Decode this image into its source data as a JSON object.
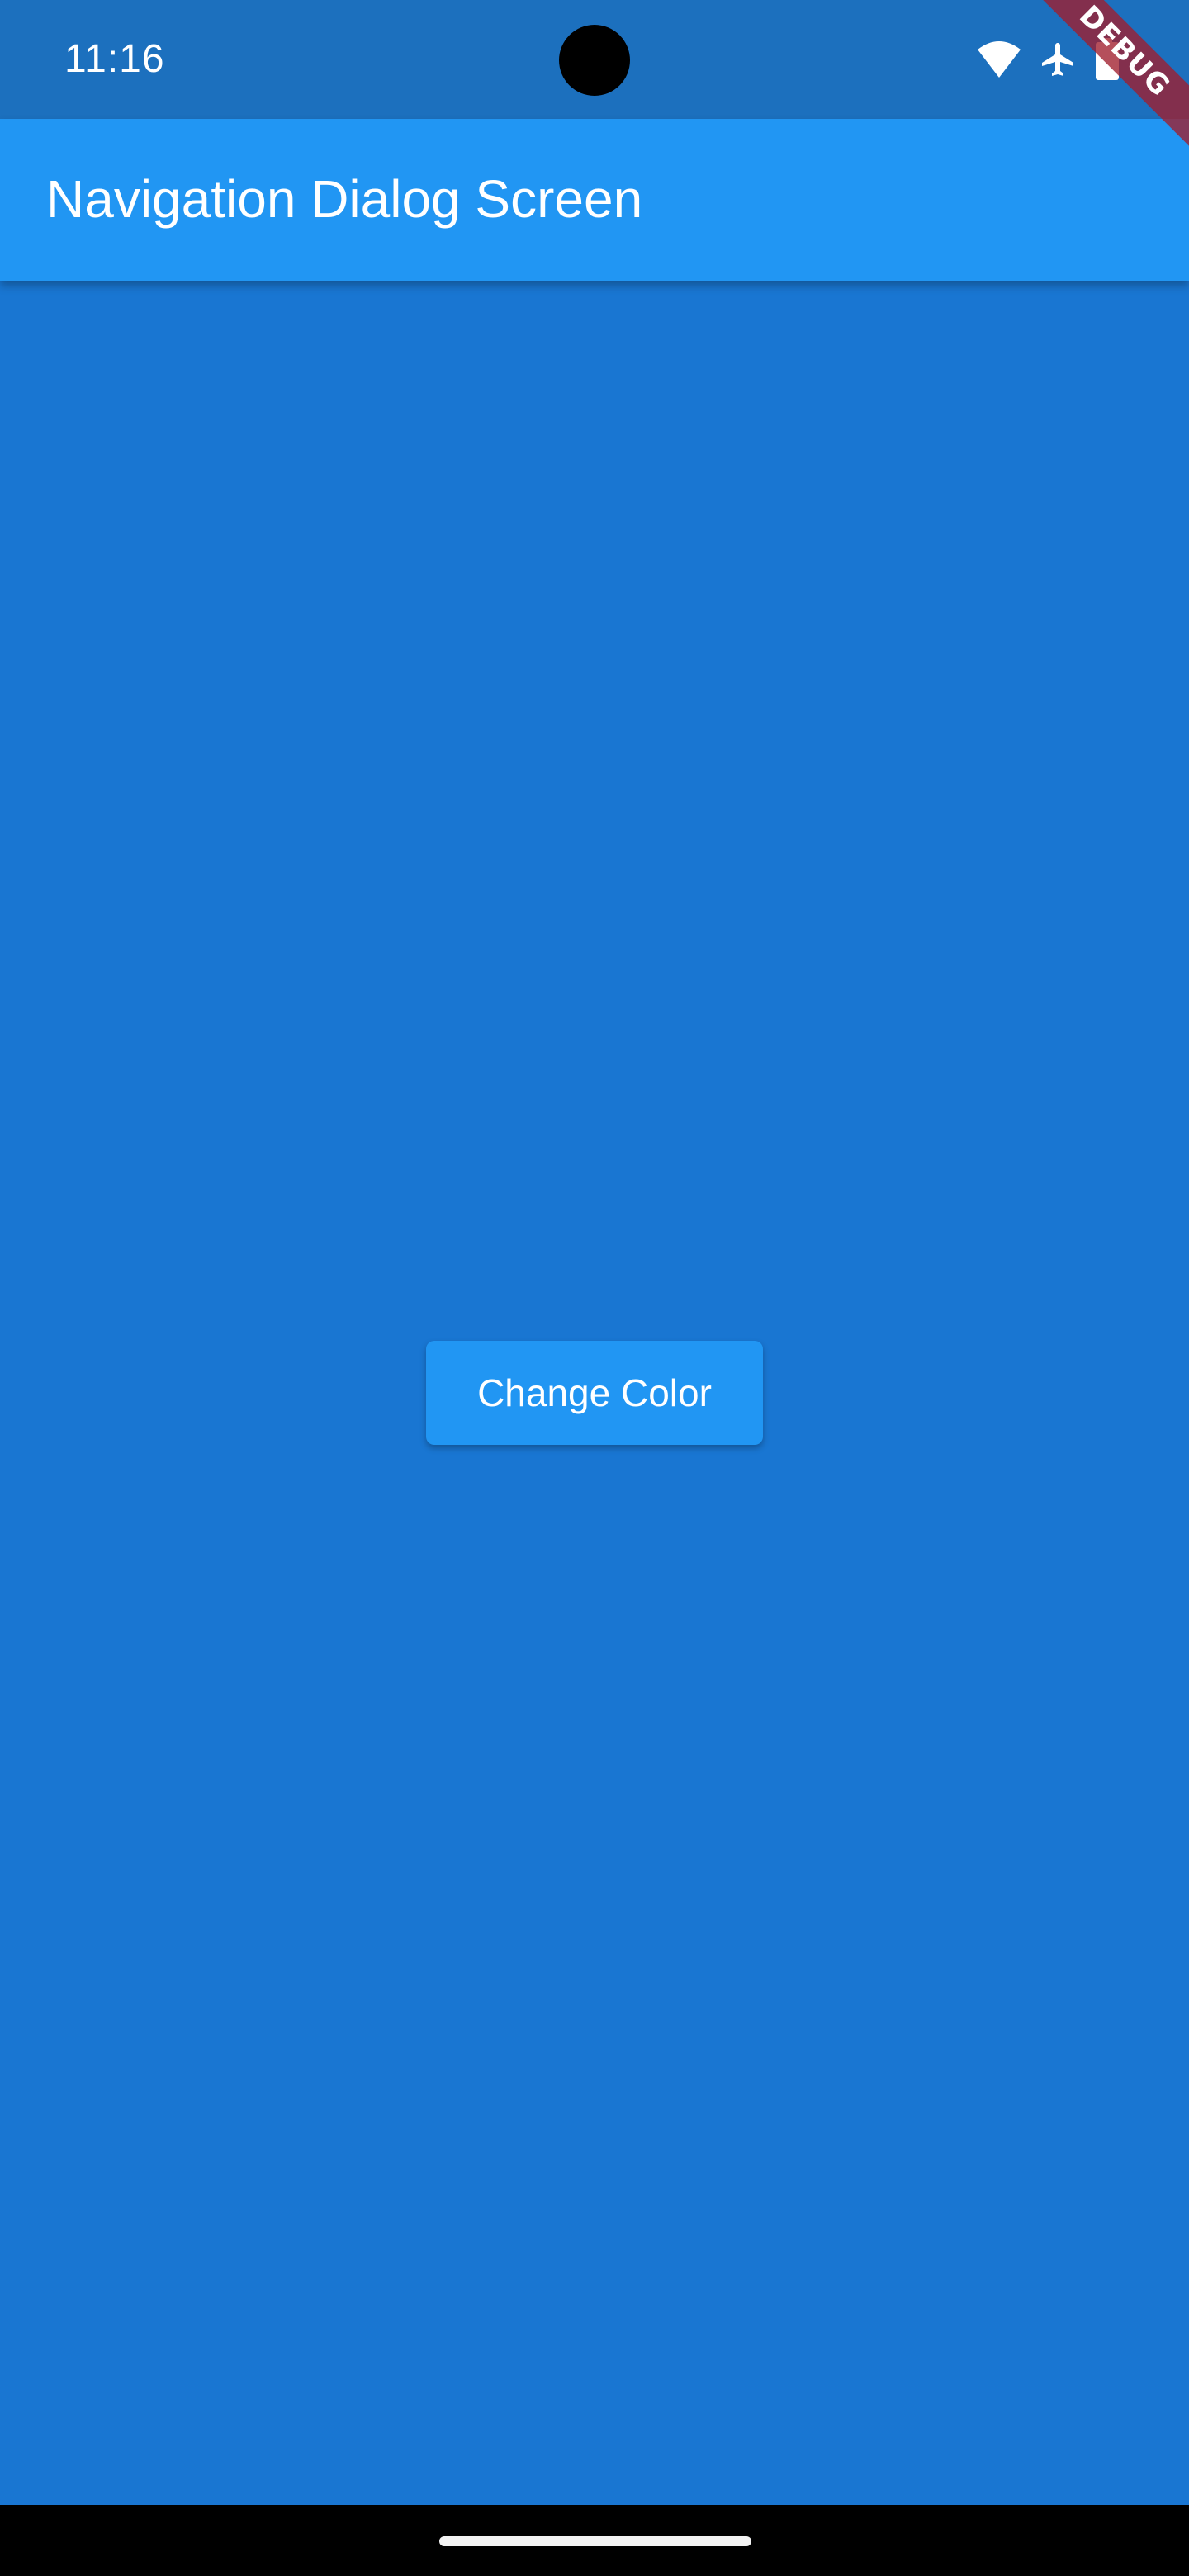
{
  "status_bar": {
    "time": "11:16",
    "icons": [
      "wifi-icon",
      "airplane-mode-icon",
      "battery-icon"
    ]
  },
  "app_bar": {
    "title": "Navigation Dialog Screen"
  },
  "main": {
    "button_label": "Change Color"
  },
  "debug_banner": {
    "label": "DEBUG"
  },
  "colors": {
    "status_bar": "#1C70BE",
    "app_bar": "#2196F3",
    "background": "#1976D2",
    "button": "#2196F3",
    "debug_banner": "#A01E2D"
  }
}
